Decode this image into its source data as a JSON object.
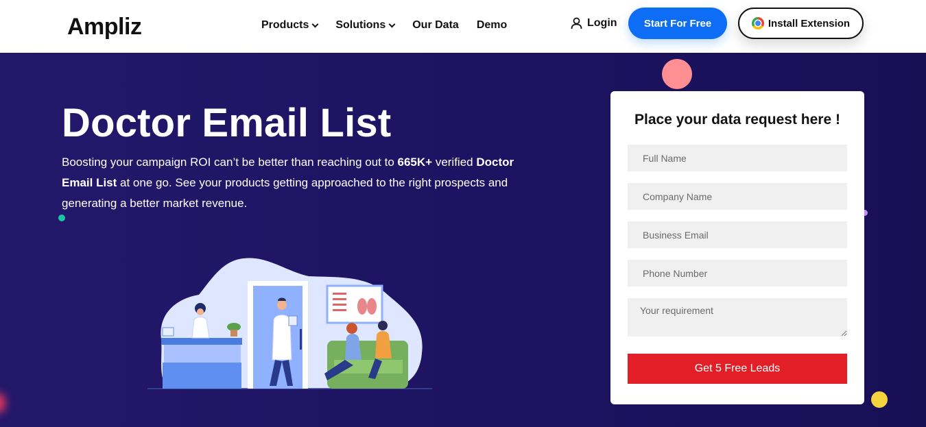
{
  "brand": {
    "logo_text": "Ampliz"
  },
  "nav": {
    "items": [
      {
        "label": "Products",
        "has_dropdown": true
      },
      {
        "label": "Solutions",
        "has_dropdown": true
      },
      {
        "label": "Our Data",
        "has_dropdown": false
      },
      {
        "label": "Demo",
        "has_dropdown": false
      }
    ],
    "login_label": "Login",
    "start_label": "Start For Free",
    "extension_label": "Install Extension",
    "icons": {
      "login": "user-icon",
      "extension": "chrome-icon"
    }
  },
  "hero": {
    "title": "Doctor Email List",
    "text_part1": "Boosting your campaign ROI can’t be better than reaching out to ",
    "text_bold1": "665K+",
    "text_part2": " verified ",
    "text_bold2": "Doctor Email List",
    "text_part3": " at one go. See your products getting approached to the right prospects and generating a better market revenue."
  },
  "form": {
    "title": "Place your data request here !",
    "fields": [
      {
        "placeholder": "Full Name",
        "value": ""
      },
      {
        "placeholder": "Company Name",
        "value": ""
      },
      {
        "placeholder": "Business Email",
        "value": ""
      },
      {
        "placeholder": "Phone Number",
        "value": ""
      }
    ],
    "requirement_placeholder": "Your requirement",
    "submit_label": "Get 5 Free Leads"
  },
  "colors": {
    "hero_bg": "#1c1260",
    "primary_blue": "#0d6ef5",
    "cta_red": "#e21f27"
  }
}
